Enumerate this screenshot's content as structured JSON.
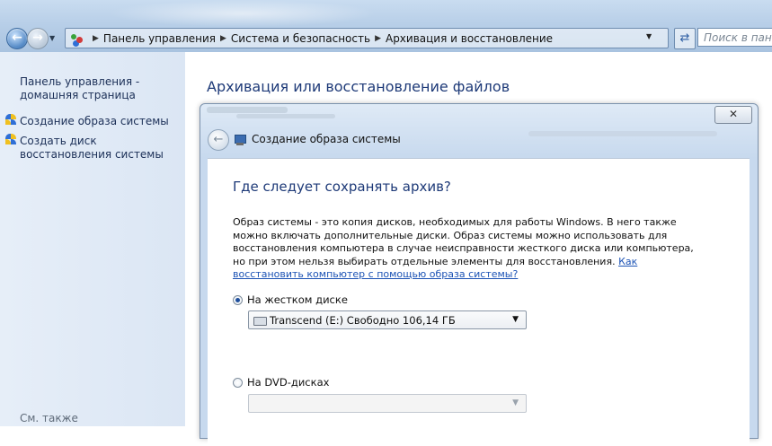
{
  "address_bar": {
    "breadcrumbs": [
      "Панель управления",
      "Система и безопасность",
      "Архивация и восстановление"
    ],
    "search_placeholder": "Поиск в панели у"
  },
  "left_pane": {
    "home_link": "Панель управления - домашняя страница",
    "tasks": [
      "Создание образа системы",
      "Создать диск восстановления системы"
    ],
    "see_also": "См. также"
  },
  "main": {
    "title": "Архивация или восстановление файлов"
  },
  "dialog": {
    "close_label": "✕",
    "caption": "Создание образа системы",
    "heading": "Где следует сохранять архив?",
    "description": "Образ системы - это копия дисков, необходимых для работы Windows. В него также можно включать дополнительные диски. Образ системы можно использовать для восстановления компьютера в случае неисправности жесткого диска или компьютера, но при этом нельзя выбирать отдельные элементы для восстановления.",
    "help_link": "Как восстановить компьютер с помощью образа системы?",
    "option_hdd": {
      "label": "На жестком диске",
      "checked": true,
      "selected_drive": "Transcend (E:)  Свободно 106,14 ГБ"
    },
    "option_dvd": {
      "label": "На DVD-дисках",
      "checked": false,
      "selected_drive": ""
    }
  }
}
